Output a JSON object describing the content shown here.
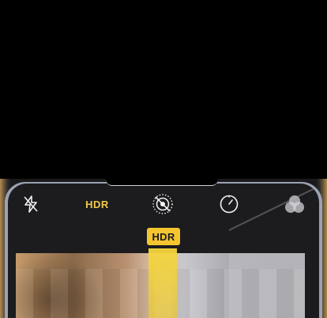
{
  "camera": {
    "top_hdr_label": "HDR",
    "hdr_badge_label": "HDR"
  },
  "icons": {
    "flash": "flash-off-icon",
    "hdr": "hdr-toggle",
    "live_photo": "live-photo-off-icon",
    "timer": "timer-icon",
    "filters": "filters-icon"
  },
  "colors": {
    "accent_yellow": "#f5c530",
    "toolbar_background": "#1c1c1e"
  }
}
